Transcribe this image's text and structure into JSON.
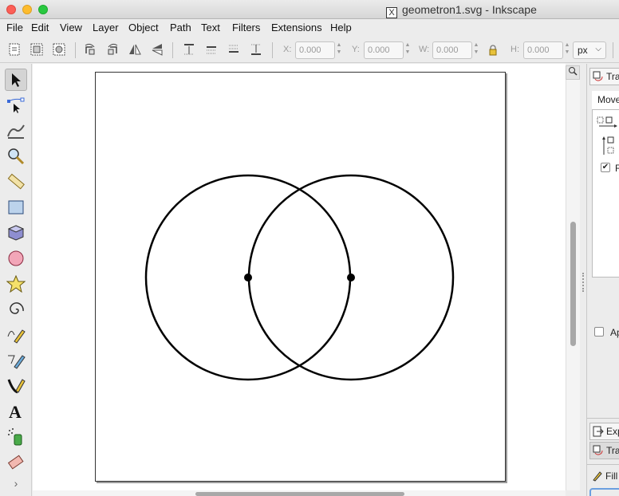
{
  "window": {
    "title": "geometron1.svg - Inkscape"
  },
  "menu": [
    "File",
    "Edit",
    "View",
    "Layer",
    "Object",
    "Path",
    "Text",
    "Filters",
    "Extensions",
    "Help"
  ],
  "toolbar": {
    "x_label": "X:",
    "x_value": "0.000",
    "y_label": "Y:",
    "y_value": "0.000",
    "w_label": "W:",
    "w_value": "0.000",
    "h_label": "H:",
    "h_value": "0.000",
    "unit": "px"
  },
  "tools": [
    "selector-icon",
    "node-editor-icon",
    "tweak-icon",
    "zoom-icon",
    "measure-icon",
    "rectangle-icon",
    "3d-box-icon",
    "ellipse-icon",
    "star-icon",
    "spiral-icon",
    "pencil-icon",
    "pen-icon",
    "calligraphy-icon",
    "text-icon",
    "spray-icon",
    "eraser-icon",
    "more-tools-chevron-icon"
  ],
  "dock": {
    "top_tab": "Tran",
    "move_tab": "Move",
    "checkbox_label_r": "R",
    "apply_label": "Ap",
    "export_tab": "Exp",
    "transform_tab": "Tra",
    "fill_tab": "Fill a"
  },
  "drawing": {
    "shapes": [
      "circle",
      "circle",
      "point",
      "point"
    ],
    "colors": {
      "stroke": "#000000"
    }
  }
}
